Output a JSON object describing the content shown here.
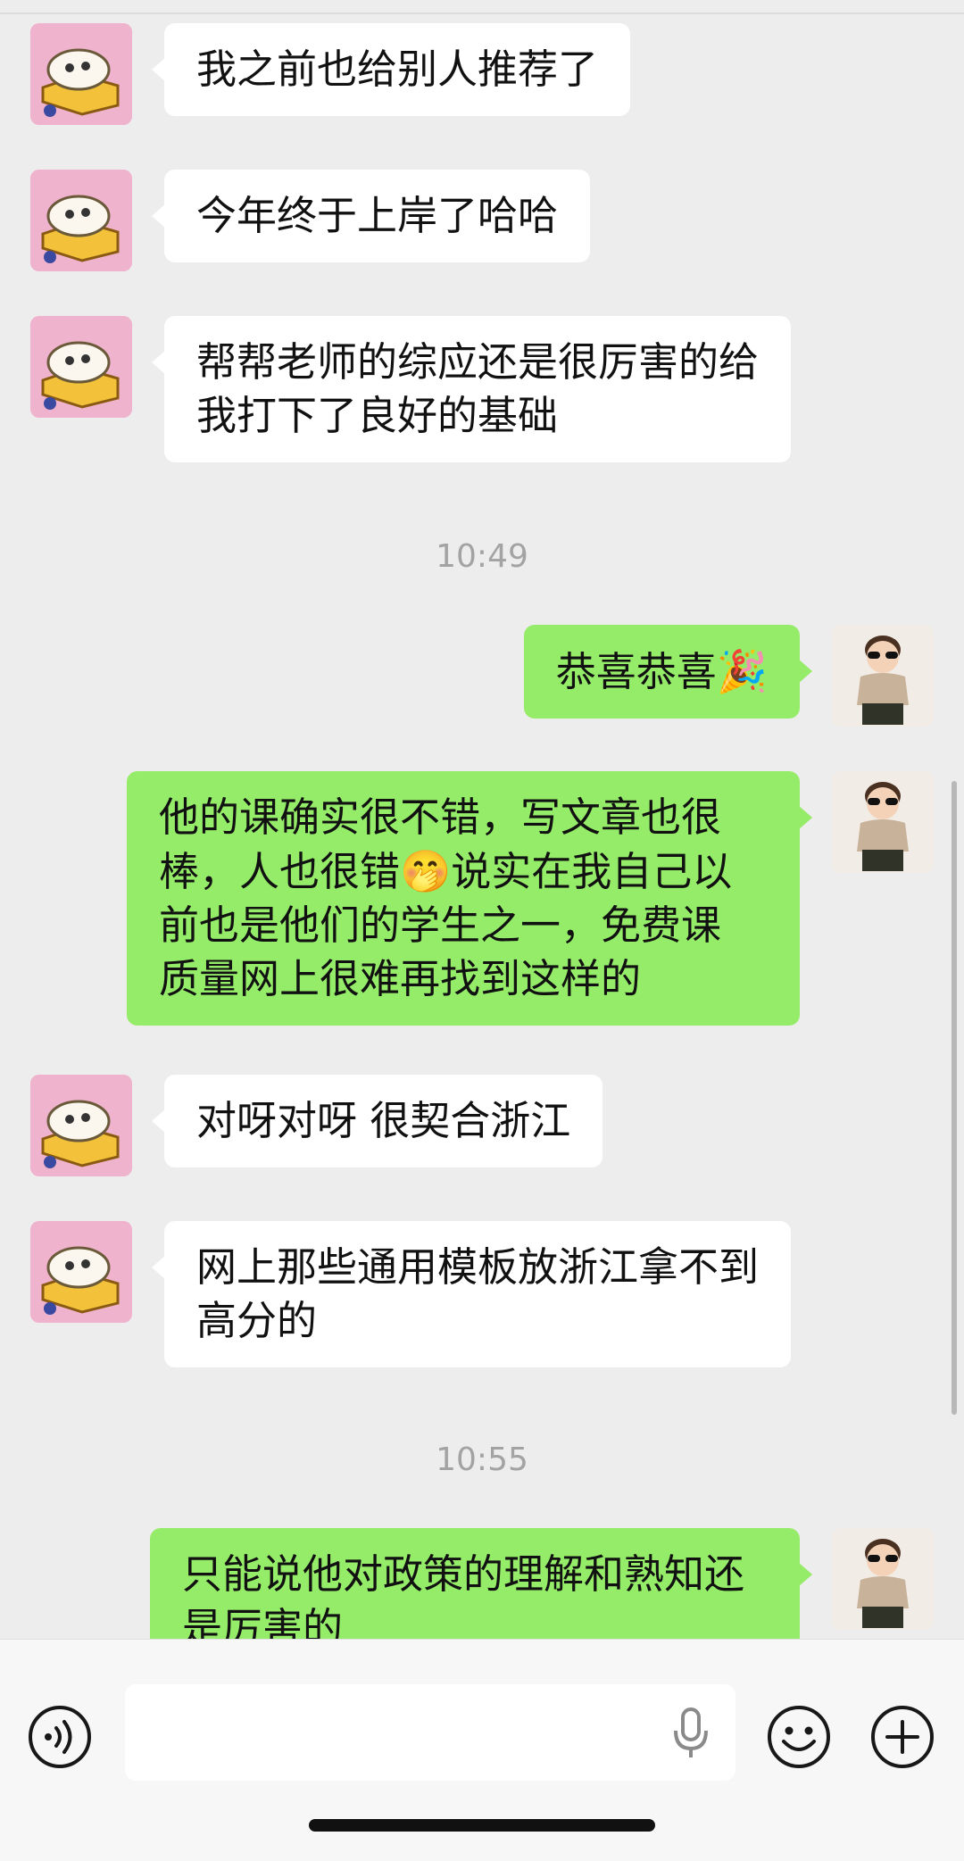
{
  "messages": [
    {
      "side": "in",
      "text": "我之前也给别人推荐了"
    },
    {
      "side": "in",
      "text": "今年终于上岸了哈哈"
    },
    {
      "side": "in",
      "text": "帮帮老师的综应还是很厉害的给\n我打下了良好的基础"
    },
    {
      "side": "time",
      "text": "10:49"
    },
    {
      "side": "out",
      "text": "恭喜恭喜",
      "emoji": "🎉"
    },
    {
      "side": "out",
      "text_a": "他的课确实很不错，写文章也很\n棒，人也很错",
      "emoji": "🤭",
      "text_b": "说实在我自己以\n前也是他们的学生之一，免费课\n质量网上很难再找到这样的"
    },
    {
      "side": "in",
      "text": "对呀对呀 很契合浙江"
    },
    {
      "side": "in",
      "text": "网上那些通用模板放浙江拿不到\n高分的"
    },
    {
      "side": "time",
      "text": "10:55"
    },
    {
      "side": "out",
      "text": "只能说他对政策的理解和熟知还\n是厉害的"
    }
  ],
  "icons": {
    "voice": "voice-toggle-icon",
    "mic": "microphone-icon",
    "emoji": "smiley-face-icon",
    "plus": "plus-icon"
  },
  "colors": {
    "background": "#ededed",
    "incoming_bubble": "#ffffff",
    "outgoing_bubble": "#95ec69",
    "timestamp": "#a3a3a3"
  }
}
